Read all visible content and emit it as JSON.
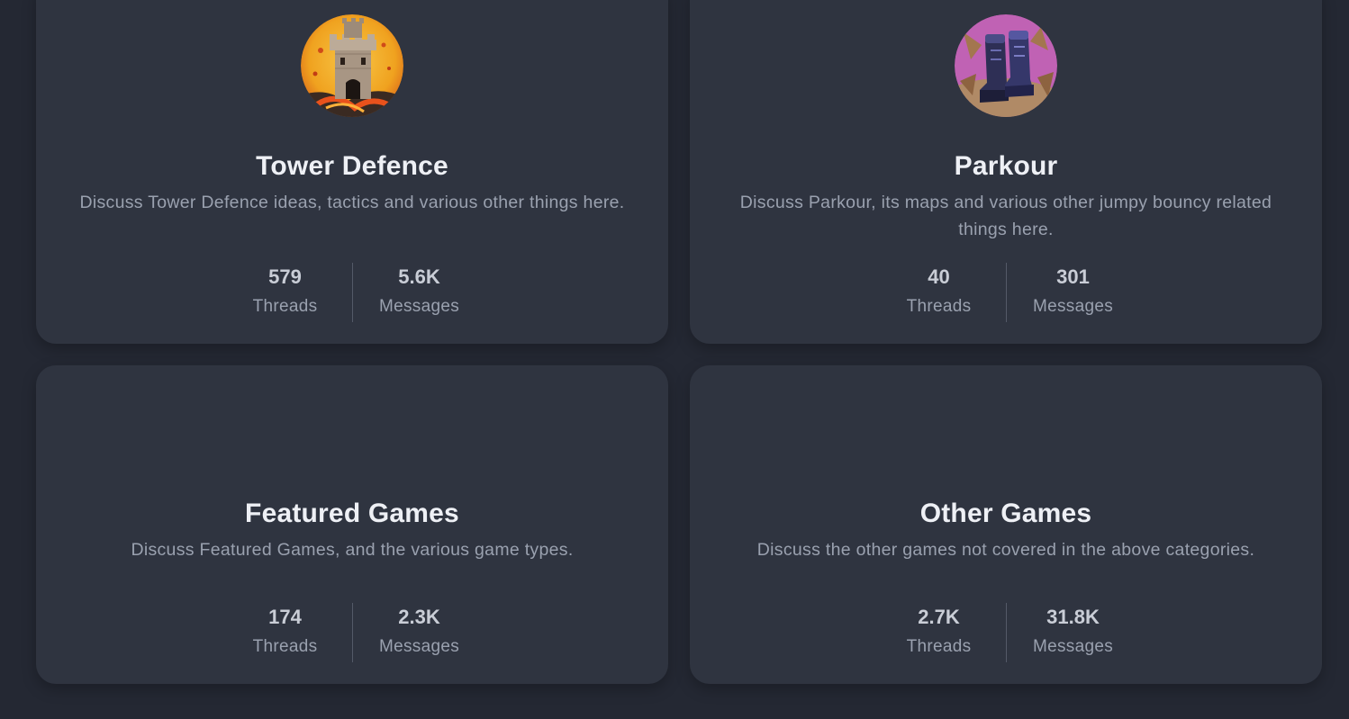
{
  "categories": [
    {
      "title": "Tower Defence",
      "description": "Discuss Tower Defence ideas, tactics and various other things here.",
      "threads": "579",
      "threads_label": "Threads",
      "messages": "5.6K",
      "messages_label": "Messages",
      "icon": "castle-icon"
    },
    {
      "title": "Parkour",
      "description": "Discuss Parkour, its maps and various other jumpy bouncy related things here.",
      "threads": "40",
      "threads_label": "Threads",
      "messages": "301",
      "messages_label": "Messages",
      "icon": "boots-icon"
    },
    {
      "title": "Featured Games",
      "description": "Discuss Featured Games, and the various game types.",
      "threads": "174",
      "threads_label": "Threads",
      "messages": "2.3K",
      "messages_label": "Messages"
    },
    {
      "title": "Other Games",
      "description": "Discuss the other games not covered in the above categories.",
      "threads": "2.7K",
      "threads_label": "Threads",
      "messages": "31.8K",
      "messages_label": "Messages"
    }
  ],
  "colors": {
    "background": "#242833",
    "card": "#2f3440",
    "title": "#eef0f5",
    "muted": "#9aa1af"
  }
}
